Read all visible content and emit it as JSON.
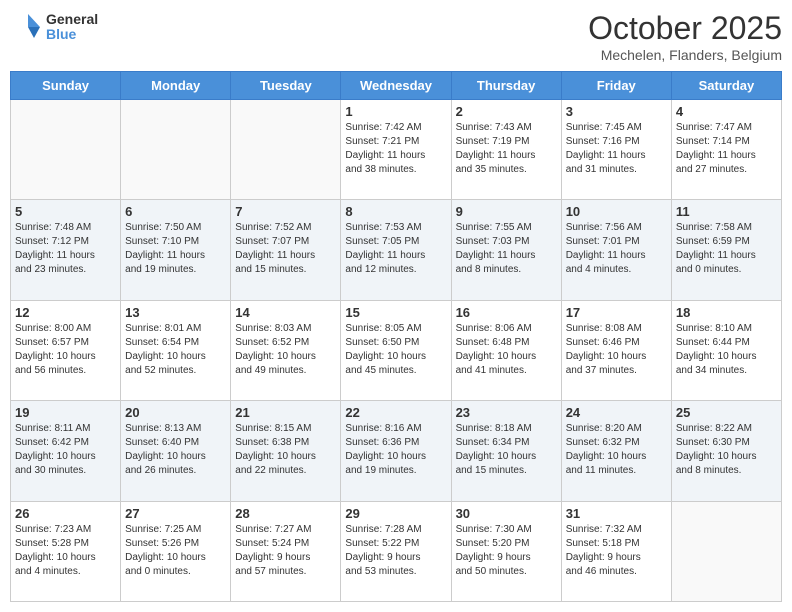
{
  "header": {
    "logo_general": "General",
    "logo_blue": "Blue",
    "month": "October 2025",
    "location": "Mechelen, Flanders, Belgium"
  },
  "weekdays": [
    "Sunday",
    "Monday",
    "Tuesday",
    "Wednesday",
    "Thursday",
    "Friday",
    "Saturday"
  ],
  "weeks": [
    [
      {
        "day": "",
        "info": ""
      },
      {
        "day": "",
        "info": ""
      },
      {
        "day": "",
        "info": ""
      },
      {
        "day": "1",
        "info": "Sunrise: 7:42 AM\nSunset: 7:21 PM\nDaylight: 11 hours\nand 38 minutes."
      },
      {
        "day": "2",
        "info": "Sunrise: 7:43 AM\nSunset: 7:19 PM\nDaylight: 11 hours\nand 35 minutes."
      },
      {
        "day": "3",
        "info": "Sunrise: 7:45 AM\nSunset: 7:16 PM\nDaylight: 11 hours\nand 31 minutes."
      },
      {
        "day": "4",
        "info": "Sunrise: 7:47 AM\nSunset: 7:14 PM\nDaylight: 11 hours\nand 27 minutes."
      }
    ],
    [
      {
        "day": "5",
        "info": "Sunrise: 7:48 AM\nSunset: 7:12 PM\nDaylight: 11 hours\nand 23 minutes."
      },
      {
        "day": "6",
        "info": "Sunrise: 7:50 AM\nSunset: 7:10 PM\nDaylight: 11 hours\nand 19 minutes."
      },
      {
        "day": "7",
        "info": "Sunrise: 7:52 AM\nSunset: 7:07 PM\nDaylight: 11 hours\nand 15 minutes."
      },
      {
        "day": "8",
        "info": "Sunrise: 7:53 AM\nSunset: 7:05 PM\nDaylight: 11 hours\nand 12 minutes."
      },
      {
        "day": "9",
        "info": "Sunrise: 7:55 AM\nSunset: 7:03 PM\nDaylight: 11 hours\nand 8 minutes."
      },
      {
        "day": "10",
        "info": "Sunrise: 7:56 AM\nSunset: 7:01 PM\nDaylight: 11 hours\nand 4 minutes."
      },
      {
        "day": "11",
        "info": "Sunrise: 7:58 AM\nSunset: 6:59 PM\nDaylight: 11 hours\nand 0 minutes."
      }
    ],
    [
      {
        "day": "12",
        "info": "Sunrise: 8:00 AM\nSunset: 6:57 PM\nDaylight: 10 hours\nand 56 minutes."
      },
      {
        "day": "13",
        "info": "Sunrise: 8:01 AM\nSunset: 6:54 PM\nDaylight: 10 hours\nand 52 minutes."
      },
      {
        "day": "14",
        "info": "Sunrise: 8:03 AM\nSunset: 6:52 PM\nDaylight: 10 hours\nand 49 minutes."
      },
      {
        "day": "15",
        "info": "Sunrise: 8:05 AM\nSunset: 6:50 PM\nDaylight: 10 hours\nand 45 minutes."
      },
      {
        "day": "16",
        "info": "Sunrise: 8:06 AM\nSunset: 6:48 PM\nDaylight: 10 hours\nand 41 minutes."
      },
      {
        "day": "17",
        "info": "Sunrise: 8:08 AM\nSunset: 6:46 PM\nDaylight: 10 hours\nand 37 minutes."
      },
      {
        "day": "18",
        "info": "Sunrise: 8:10 AM\nSunset: 6:44 PM\nDaylight: 10 hours\nand 34 minutes."
      }
    ],
    [
      {
        "day": "19",
        "info": "Sunrise: 8:11 AM\nSunset: 6:42 PM\nDaylight: 10 hours\nand 30 minutes."
      },
      {
        "day": "20",
        "info": "Sunrise: 8:13 AM\nSunset: 6:40 PM\nDaylight: 10 hours\nand 26 minutes."
      },
      {
        "day": "21",
        "info": "Sunrise: 8:15 AM\nSunset: 6:38 PM\nDaylight: 10 hours\nand 22 minutes."
      },
      {
        "day": "22",
        "info": "Sunrise: 8:16 AM\nSunset: 6:36 PM\nDaylight: 10 hours\nand 19 minutes."
      },
      {
        "day": "23",
        "info": "Sunrise: 8:18 AM\nSunset: 6:34 PM\nDaylight: 10 hours\nand 15 minutes."
      },
      {
        "day": "24",
        "info": "Sunrise: 8:20 AM\nSunset: 6:32 PM\nDaylight: 10 hours\nand 11 minutes."
      },
      {
        "day": "25",
        "info": "Sunrise: 8:22 AM\nSunset: 6:30 PM\nDaylight: 10 hours\nand 8 minutes."
      }
    ],
    [
      {
        "day": "26",
        "info": "Sunrise: 7:23 AM\nSunset: 5:28 PM\nDaylight: 10 hours\nand 4 minutes."
      },
      {
        "day": "27",
        "info": "Sunrise: 7:25 AM\nSunset: 5:26 PM\nDaylight: 10 hours\nand 0 minutes."
      },
      {
        "day": "28",
        "info": "Sunrise: 7:27 AM\nSunset: 5:24 PM\nDaylight: 9 hours\nand 57 minutes."
      },
      {
        "day": "29",
        "info": "Sunrise: 7:28 AM\nSunset: 5:22 PM\nDaylight: 9 hours\nand 53 minutes."
      },
      {
        "day": "30",
        "info": "Sunrise: 7:30 AM\nSunset: 5:20 PM\nDaylight: 9 hours\nand 50 minutes."
      },
      {
        "day": "31",
        "info": "Sunrise: 7:32 AM\nSunset: 5:18 PM\nDaylight: 9 hours\nand 46 minutes."
      },
      {
        "day": "",
        "info": ""
      }
    ]
  ]
}
